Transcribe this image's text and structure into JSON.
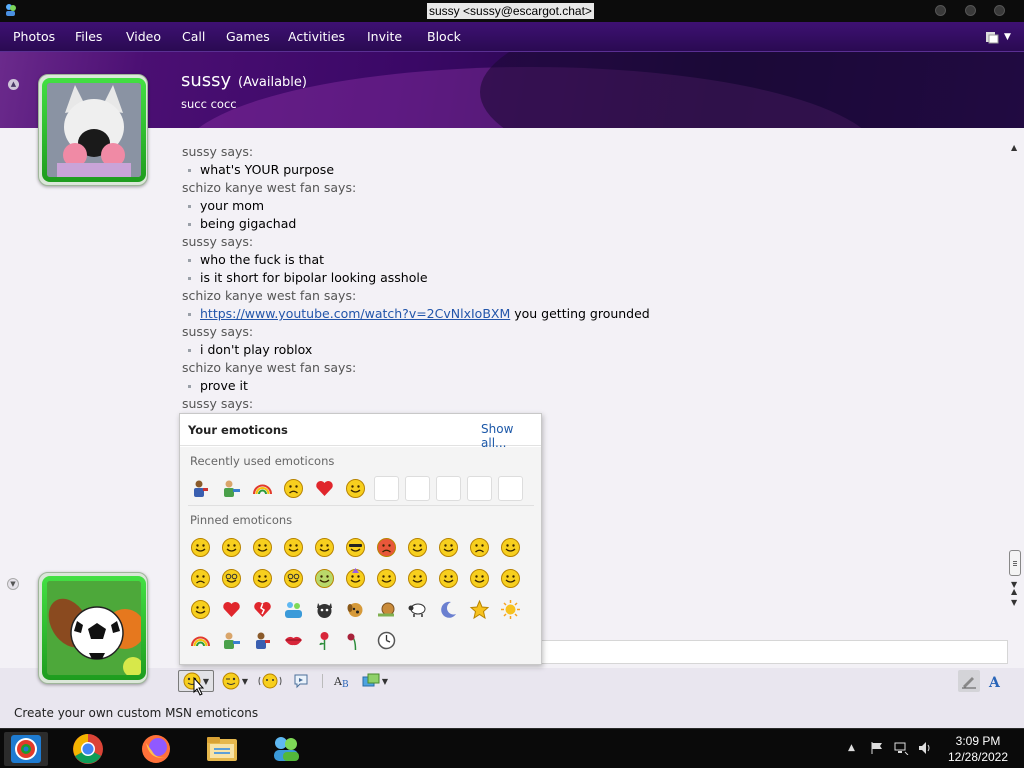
{
  "window": {
    "title": "sussy <sussy@escargot.chat>"
  },
  "menu": {
    "items": [
      "Photos",
      "Files",
      "Video",
      "Call",
      "Games",
      "Activities",
      "Invite",
      "Block"
    ],
    "display_pictures_icon": "display-options-icon"
  },
  "contact": {
    "name": "sussy",
    "status": "(Available)",
    "personal_message": "succ cocc"
  },
  "conversation": {
    "messages": [
      {
        "sender": "sussy says:",
        "lines": [
          "what's YOUR purpose"
        ]
      },
      {
        "sender": "schizo kanye west fan says:",
        "lines": [
          "your mom",
          "being gigachad"
        ]
      },
      {
        "sender": "sussy says:",
        "lines": [
          "who the fuck is that",
          "is it short for bipolar looking asshole"
        ]
      },
      {
        "sender": "schizo kanye west fan says:",
        "link": "https://www.youtube.com/watch?v=2CvNlxIoBXM",
        "link_suffix": " you getting grounded"
      },
      {
        "sender": "sussy says:",
        "lines": [
          "i don't play roblox"
        ]
      },
      {
        "sender": "schizo kanye west fan says:",
        "lines": [
          "prove it"
        ]
      },
      {
        "sender": "sussy says:",
        "lines": []
      }
    ]
  },
  "emoticon_picker": {
    "title": "Your emoticons",
    "show_all": "Show all...",
    "recent_label": "Recently used emoticons",
    "recent": [
      "man-icon",
      "handshake-icon",
      "rainbow-icon",
      "sad-icon",
      "red-heart-icon",
      "happy-icon",
      "",
      "",
      "",
      "",
      ""
    ],
    "pinned_label": "Pinned emoticons",
    "pinned": [
      "smile-icon",
      "big-smile-icon",
      "wink-icon",
      "surprised-icon",
      "tongue-icon",
      "cool-icon",
      "angry-icon",
      "confused-icon",
      "embarrassed-icon",
      "sad-icon",
      "crying-icon",
      "disappointed-icon",
      "nerd-icon",
      "sarcastic-icon",
      "glasses-icon",
      "sick-icon",
      "party-icon",
      "secret-icon",
      "eye-roll-icon",
      "thinking-icon",
      "baring-teeth-icon",
      "smirk-icon",
      "shy-icon",
      "heart-icon",
      "broken-heart-icon",
      "people-icon",
      "cat-icon",
      "dog-icon",
      "snail-icon",
      "sheep-icon",
      "moon-icon",
      "star-icon",
      "sun-icon",
      "rainbow-icon",
      "handshake-icon",
      "man-icon",
      "lips-icon",
      "rose-icon",
      "wilted-rose-icon",
      "clock-icon"
    ]
  },
  "toolbar": {
    "emoticon_button": "emoticon-icon",
    "wink_button": "wink-icon",
    "nudge_button": "nudge-icon",
    "voice_clip_button": "voice-clip-icon",
    "font_button": "font-icon",
    "background_button": "background-icon",
    "handwriting_button": "handwriting-icon",
    "text_button": "text-icon"
  },
  "status_bar": {
    "text": "Create your own custom MSN emoticons"
  },
  "taskbar": {
    "time": "3:09 PM",
    "date": "12/28/2022",
    "apps": [
      "msn-messenger-icon",
      "chrome-icon",
      "firefox-icon",
      "file-explorer-icon",
      "msn-contacts-icon"
    ]
  },
  "colors": {
    "menu_bar": "#3e1173",
    "banner": "#3a0866",
    "avatar_frame": "#2fc52f",
    "link": "#2255aa",
    "accent_text": "#1c58a8"
  }
}
